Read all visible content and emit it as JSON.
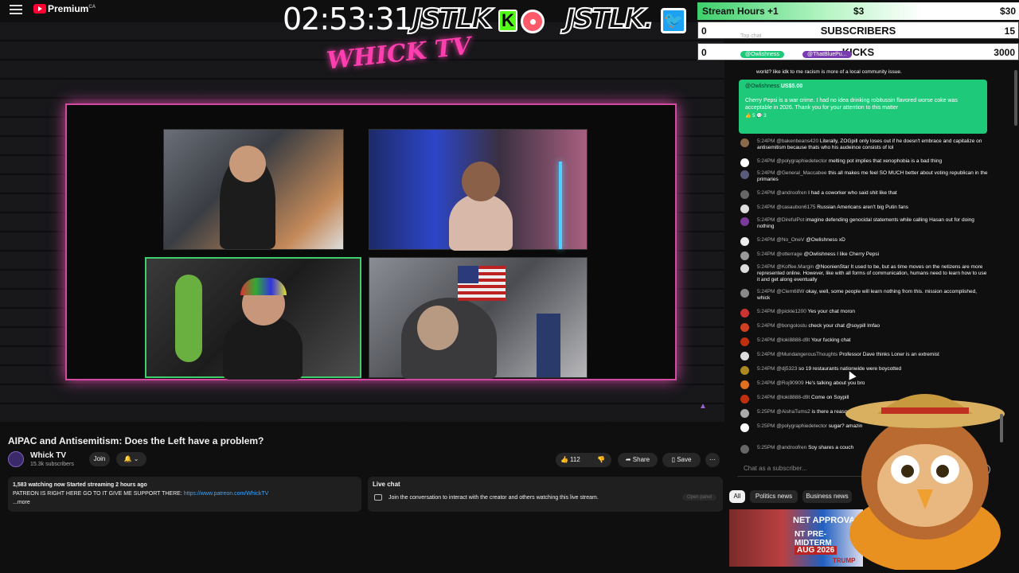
{
  "app": {
    "logo_text": "Premium",
    "region": "CA"
  },
  "overlay": {
    "timer": "02:53:31",
    "brand_left": "JSTLK",
    "brand_right": "JSTLK.",
    "kick_letter": "K",
    "twitter_glyph": "🐦",
    "channel_logo": "WHICK TV",
    "stats": {
      "row1": {
        "label": "Stream Hours +1",
        "mid": "$3",
        "end": "$30"
      },
      "row2": {
        "left": "0",
        "center": "SUBSCRIBERS",
        "right": "15"
      },
      "row3": {
        "left": "0",
        "center": "KICKS",
        "right": "3000"
      }
    }
  },
  "video": {
    "title": "AIPAC and Antisemitism: Does the Left have a problem?",
    "channel": "Whick TV",
    "subscribers": "15.3k subscribers",
    "join_label": "Join",
    "likes": "112",
    "share_label": "Share",
    "save_label": "Save",
    "description": {
      "line1": "1,583 watching now  Started streaming 2 hours ago",
      "line2_prefix": "PATREON IS RIGHT HERE GO TO IT GIVE ME SUPPORT THERE: ",
      "link": "https://www.patreon.com/WhickTV",
      "more": "...more"
    }
  },
  "livechat_box": {
    "header": "Live chat",
    "text": "Join the conversation to interact with the creator and others watching this live stream.",
    "open_panel": "Open panel"
  },
  "chat": {
    "header": "Top chat",
    "pinned_names": [
      "@Owlishness",
      "@ThatBluePu..."
    ],
    "super_chat": {
      "name": "@Owlishness",
      "amount": "US$5.00",
      "text": "Cherry Pepsi is a war crime. I had no idea drinking robitussin flavored worse coke was acceptable in 2026. Thank you for your attention to this matter",
      "meta": "👍 5   💬 3"
    },
    "top_text": "world? like idk to me racism is more of a local community issue.",
    "messages": [
      {
        "time": "5:24PM",
        "author": "@bakenbeans420",
        "text": "Literally, ZOGpill only loses out if he doesn't embrace and capitalize on antisemitism because thats who his audeince consists of lol",
        "color": "#8a6a4a"
      },
      {
        "time": "5:24PM",
        "author": "@polygraphiedetector",
        "text": "melting pot implies that xenophobia is a bad thing",
        "color": "#ffffff"
      },
      {
        "time": "5:24PM",
        "author": "@General_Maccabee",
        "text": "this all makes me feel SO MUCH better about voting republican in the primaries",
        "color": "#5a5a7a"
      },
      {
        "time": "5:24PM",
        "author": "@androofren",
        "text": "I had a coworker who said shit like that",
        "color": "#666666"
      },
      {
        "time": "5:24PM",
        "author": "@casaubon6175",
        "text": "Russian Americans aren't big Putin fans",
        "color": "#dddddd"
      },
      {
        "time": "5:24PM",
        "author": "@DirefulPot",
        "text": "imagine defending genocidal statements while calling Hasan out for doing nothing",
        "color": "#7a3a9a"
      },
      {
        "time": "5:24PM",
        "author": "@No_OneV",
        "text": "@Owlishness  xD",
        "color": "#eeeeee"
      },
      {
        "time": "5:24PM",
        "author": "@otterrage",
        "text": "@Owlishness  I like Cherry Pepsi",
        "color": "#999999"
      },
      {
        "time": "5:24PM",
        "author": "@Koffee.Margin",
        "text": "@NoonienStar It used to be, but as time moves on the netizens are more represented online. However, like with all forms of communication, humans need to learn how to use it and get along eventually",
        "color": "#dddddd"
      },
      {
        "time": "5:24PM",
        "author": "@Clem68W",
        "text": "okay, well, some people will learn nothing from this. mission accomplished, whick",
        "color": "#888888"
      },
      {
        "time": "5:24PM",
        "author": "@pickle1200",
        "text": "Yes your chat moron",
        "color": "#cc3333"
      },
      {
        "time": "5:24PM",
        "author": "@bongolostu",
        "text": "check your chat @soypill lmfao",
        "color": "#d04020"
      },
      {
        "time": "5:24PM",
        "author": "@loki8888-d9t",
        "text": "Your fucking chat",
        "color": "#c03010"
      },
      {
        "time": "5:24PM",
        "author": "@MundangerousThoughts",
        "text": "Professor Dave thinks Loner is an extremist",
        "color": "#dddddd"
      },
      {
        "time": "5:24PM",
        "author": "@dj5323",
        "text": "so 19 restaurants nationwide were boycotted",
        "color": "#aa8a20"
      },
      {
        "time": "5:24PM",
        "author": "@Roj90909",
        "text": "He's talking about you bro",
        "color": "#e07020"
      },
      {
        "time": "5:24PM",
        "author": "@loki8888-d9t",
        "text": "Come on Soypill",
        "color": "#c03010"
      },
      {
        "time": "5:25PM",
        "author": "@AishaTums2",
        "text": "is there a reason soy?",
        "color": "#aaaaaa"
      },
      {
        "time": "5:25PM",
        "author": "@polygraphiedetector",
        "text": "sugar? amazin",
        "color": "#ffffff"
      },
      {
        "time": "5:25PM",
        "author": "@androofren",
        "text": "Soy shares a couch",
        "color": "#666666"
      }
    ],
    "input_placeholder": "Chat as a subscriber...",
    "chips": [
      "All",
      "Politics news",
      "Business news"
    ],
    "thumbnail": {
      "line1": "NET APPROVAL",
      "line2": "NT PRE-MIDTERM",
      "date": "AUG 2026",
      "tag": "TRUMP"
    }
  }
}
